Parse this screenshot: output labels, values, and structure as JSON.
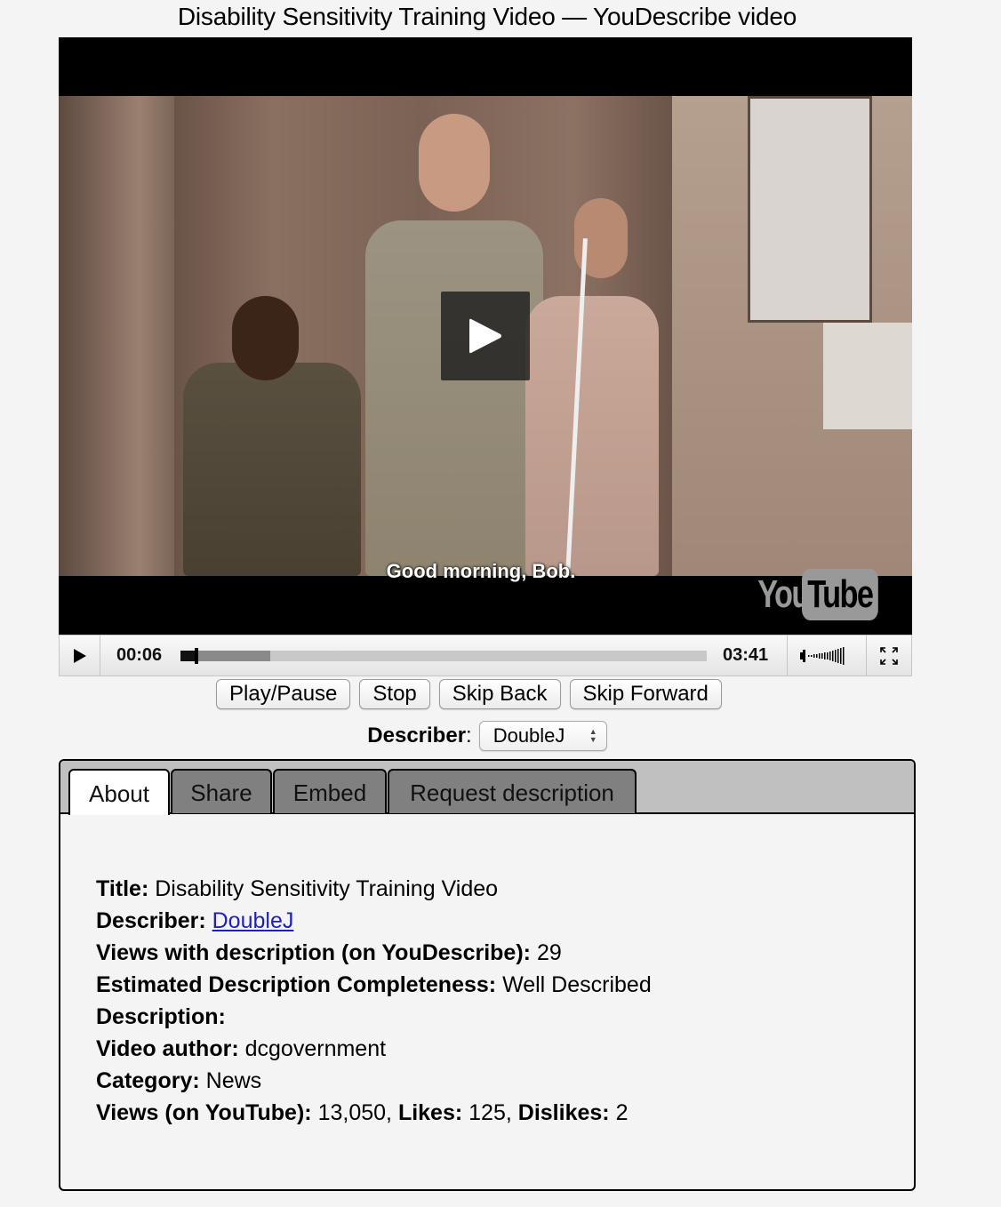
{
  "page": {
    "title": "Disability Sensitivity Training Video — YouDescribe video"
  },
  "player": {
    "subtitle": "Good morning, Bob.",
    "logo_you": "You",
    "logo_tube": "Tube",
    "current_time": "00:06",
    "duration": "03:41",
    "played_fraction": 0.027,
    "buffered_fraction": 0.17,
    "icons": {
      "play": "play-icon",
      "big_play": "big-play-icon",
      "volume": "volume-icon",
      "fullscreen": "fullscreen-icon"
    }
  },
  "buttons": {
    "play_pause": "Play/Pause",
    "stop": "Stop",
    "skip_back": "Skip Back",
    "skip_forward": "Skip Forward"
  },
  "describer": {
    "label": "Describer",
    "colon": ":",
    "selected": "DoubleJ"
  },
  "tabs": [
    {
      "label": "About",
      "active": true
    },
    {
      "label": "Share",
      "active": false
    },
    {
      "label": "Embed",
      "active": false
    },
    {
      "label": "Request description",
      "active": false
    }
  ],
  "about": {
    "title_label": "Title:",
    "title_value": "Disability Sensitivity Training Video",
    "describer_label": "Describer:",
    "describer_value": "DoubleJ",
    "views_desc_label": "Views with description (on YouDescribe):",
    "views_desc_value": "29",
    "completeness_label": "Estimated Description Completeness:",
    "completeness_value": "Well Described",
    "description_label": "Description:",
    "description_value": "",
    "author_label": "Video author:",
    "author_value": "dcgovernment",
    "category_label": "Category:",
    "category_value": "News",
    "yt_views_label": "Views (on YouTube):",
    "yt_views_value": "13,050,",
    "likes_label": "Likes:",
    "likes_value": "125,",
    "dislikes_label": "Dislikes:",
    "dislikes_value": "2"
  }
}
